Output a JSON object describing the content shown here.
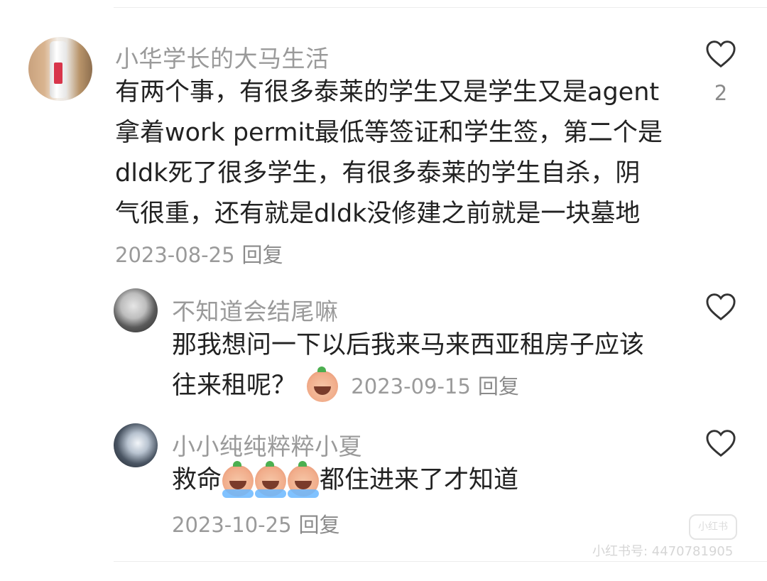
{
  "comments": [
    {
      "username": "小华学长的大马生活",
      "lines": [
        "有两个事，有很多泰莱的学生又是学生又是agent",
        "拿着work permit最低等签证和学生签，第二个是",
        "dldk死了很多学生，有很多泰莱的学生自杀，阴",
        "气很重，还有就是dldk没修建之前就是一块墓地"
      ],
      "date": "2023-08-25",
      "reply_label": "回复",
      "like_count": "2"
    },
    {
      "username": "不知道会结尾嘛",
      "line1": "那我想问一下以后我来马来西亚租房子应该",
      "line2": "往来租呢？",
      "emoji": "crying-face-emoji",
      "date": "2023-09-15",
      "reply_label": "回复"
    },
    {
      "username": "小小纯纯粹粹小夏",
      "text_before": "救命",
      "emojis": [
        "crying-face-emoji",
        "crying-face-emoji",
        "crying-face-emoji"
      ],
      "text_after": "都住进来了才知道",
      "date": "2023-10-25",
      "reply_label": "回复"
    }
  ],
  "watermark": {
    "logo_text": "小红书",
    "id_text": "小红书号: 4470781905"
  },
  "colors": {
    "username": "#9a9a9a",
    "body": "#222222",
    "meta": "#9a9a9a",
    "heart_stroke": "#333333"
  }
}
